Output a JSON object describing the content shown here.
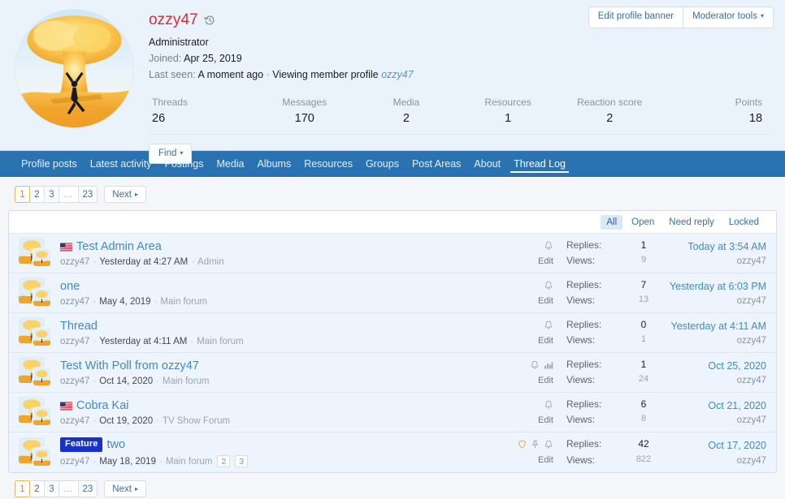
{
  "profile": {
    "username": "ozzy47",
    "history_icon": "history-icon",
    "user_title": "Administrator",
    "joined_label": "Joined:",
    "joined_value": "Apr 25, 2019",
    "last_seen_label": "Last seen:",
    "last_seen_value": "A moment ago",
    "last_seen_separator": "·",
    "last_seen_activity": "Viewing member profile",
    "last_seen_link": "ozzy47",
    "avatar_alt": "mushroom-cloud-avatar"
  },
  "banner_actions": {
    "edit_banner_label": "Edit profile banner",
    "moderator_tools_label": "Moderator tools",
    "caret": "▾"
  },
  "stats": [
    {
      "label": "Threads",
      "value": "26"
    },
    {
      "label": "Messages",
      "value": "170"
    },
    {
      "label": "Media",
      "value": "2"
    },
    {
      "label": "Resources",
      "value": "1"
    },
    {
      "label": "Reaction score",
      "value": "2"
    },
    {
      "label": "Points",
      "value": "18"
    }
  ],
  "find": {
    "label": "Find",
    "caret": "▾"
  },
  "nav": {
    "items": [
      {
        "label": "Profile posts",
        "active": false
      },
      {
        "label": "Latest activity",
        "active": false
      },
      {
        "label": "Postings",
        "active": false
      },
      {
        "label": "Media",
        "active": false
      },
      {
        "label": "Albums",
        "active": false
      },
      {
        "label": "Resources",
        "active": false
      },
      {
        "label": "Groups",
        "active": false
      },
      {
        "label": "Post Areas",
        "active": false
      },
      {
        "label": "About",
        "active": false
      },
      {
        "label": "Thread Log",
        "active": true
      }
    ]
  },
  "pagination": {
    "pages": [
      "1",
      "2",
      "3",
      "…",
      "23"
    ],
    "current": "1",
    "next_label": "Next",
    "next_arrow": "▸"
  },
  "filters": {
    "items": [
      {
        "label": "All",
        "active": true
      },
      {
        "label": "Open",
        "active": false
      },
      {
        "label": "Need reply",
        "active": false
      },
      {
        "label": "Locked",
        "active": false
      }
    ]
  },
  "thread_table": {
    "replies_label": "Replies:",
    "views_label": "Views:",
    "edit_label": "Edit",
    "rows": [
      {
        "flag": "us-flag-icon",
        "badge": null,
        "title": "Test Admin Area",
        "author": "ozzy47",
        "date": "Yesterday at 4:27 AM",
        "forum": "Admin",
        "pages": [],
        "icons": [
          "bell-icon"
        ],
        "replies": "1",
        "views": "9",
        "last_date": "Today at 3:54 AM",
        "last_user": "ozzy47"
      },
      {
        "flag": null,
        "badge": null,
        "title": "one",
        "author": "ozzy47",
        "date": "May 4, 2019",
        "forum": "Main forum",
        "pages": [],
        "icons": [
          "bell-icon"
        ],
        "replies": "7",
        "views": "13",
        "last_date": "Yesterday at 6:03 PM",
        "last_user": "ozzy47"
      },
      {
        "flag": null,
        "badge": null,
        "title": "Thread",
        "author": "ozzy47",
        "date": "Yesterday at 4:11 AM",
        "forum": "Main forum",
        "pages": [],
        "icons": [
          "bell-icon"
        ],
        "replies": "0",
        "views": "1",
        "last_date": "Yesterday at 4:11 AM",
        "last_user": "ozzy47"
      },
      {
        "flag": null,
        "badge": null,
        "title": "Test With Poll from ozzy47",
        "author": "ozzy47",
        "date": "Oct 14, 2020",
        "forum": "Main forum",
        "pages": [],
        "icons": [
          "bell-icon",
          "poll-icon"
        ],
        "replies": "1",
        "views": "24",
        "last_date": "Oct 25, 2020",
        "last_user": "ozzy47"
      },
      {
        "flag": "us-flag-icon",
        "badge": null,
        "title": "Cobra Kai",
        "author": "ozzy47",
        "date": "Oct 19, 2020",
        "forum": "TV Show Forum",
        "pages": [],
        "icons": [
          "bell-icon"
        ],
        "replies": "6",
        "views": "8",
        "last_date": "Oct 21, 2020",
        "last_user": "ozzy47"
      },
      {
        "flag": null,
        "badge": "Feature",
        "title": "two",
        "author": "ozzy47",
        "date": "May 18, 2019",
        "forum": "Main forum",
        "pages": [
          "2",
          "3"
        ],
        "icons": [
          "shield-icon",
          "pin-icon",
          "bell-icon"
        ],
        "replies": "42",
        "views": "822",
        "last_date": "Oct 17, 2020",
        "last_user": "ozzy47"
      }
    ]
  },
  "colors": {
    "nav_bg": "#2a72b0",
    "banner_bg": "#eaf2fc",
    "row_bg": "#eef4fd",
    "link": "#3f8ac9",
    "username": "#d32f2f",
    "badge_bg": "#1732c4",
    "shield": "#e8a33d",
    "current_page_border": "#e3b860"
  }
}
